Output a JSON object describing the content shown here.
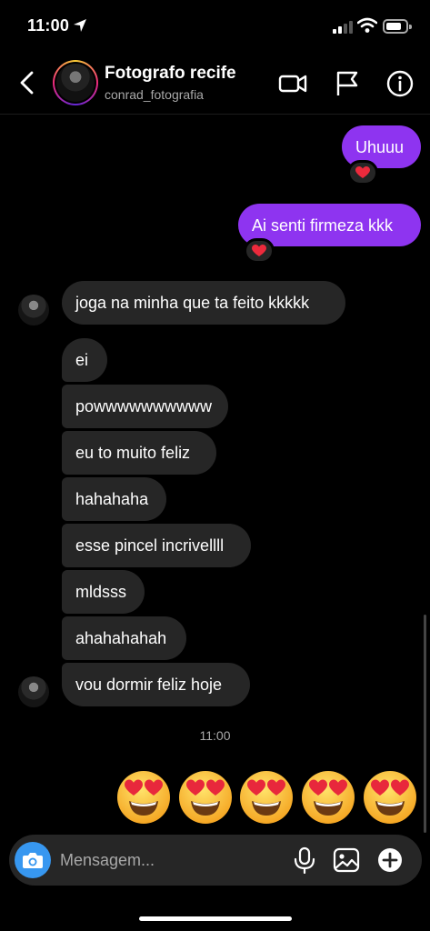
{
  "status": {
    "time": "11:00"
  },
  "header": {
    "title": "Fotografo recife",
    "username": "conrad_fotografia"
  },
  "messages": {
    "sent": [
      "Uhuuu",
      "Ai senti firmeza kkk"
    ],
    "received": [
      "joga na minha que ta feito kkkkk",
      "ei",
      "powwwwwwwwww",
      "eu to muito feliz",
      "hahahaha",
      "esse pincel incrivellll",
      "mldsss",
      "ahahahahah",
      "vou dormir feliz hoje"
    ]
  },
  "reaction_emoji": "heart",
  "timestamp": "11:00",
  "emoji_message": [
    "smiling-face-with-heart-eyes",
    "smiling-face-with-heart-eyes",
    "smiling-face-with-heart-eyes",
    "smiling-face-with-heart-eyes",
    "smiling-face-with-heart-eyes"
  ],
  "composer": {
    "placeholder": "Mensagem..."
  },
  "icons": [
    "back-icon",
    "video-call-icon",
    "flag-icon",
    "info-icon",
    "camera-icon",
    "microphone-icon",
    "gallery-icon",
    "plus-icon"
  ],
  "colors": {
    "sent_bubble": "#8e34f0",
    "received_bubble": "#262626",
    "camera_button": "#3797f0",
    "background": "#000000"
  }
}
